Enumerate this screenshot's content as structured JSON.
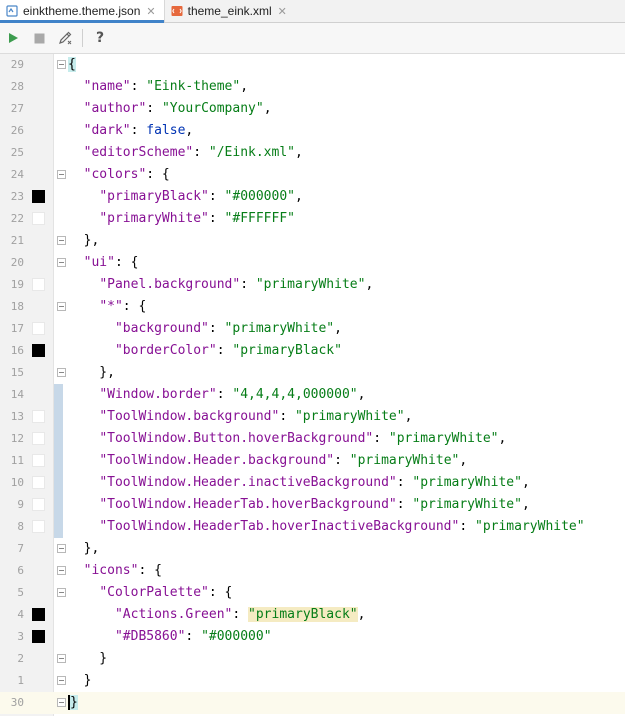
{
  "tabs": [
    {
      "label": "einktheme.theme.json",
      "icon": "json-file-icon",
      "close": "✕"
    },
    {
      "label": "theme_eink.xml",
      "icon": "xml-file-icon",
      "close": "✕"
    }
  ],
  "toolbar": {
    "run_icon": "play-icon",
    "stop_icon": "stop-icon",
    "edit_icon": "pencil-icon",
    "help_label": "?"
  },
  "colors": {
    "accent": "#4083c9",
    "key": "#871094",
    "string": "#067d17",
    "boolean": "#0033b3",
    "swatch_black": "#000000",
    "swatch_white": "#FFFFFF"
  },
  "lines": [
    {
      "num": "29",
      "segs": [
        {
          "t": "{",
          "c": "p brace-match"
        }
      ]
    },
    {
      "num": "28",
      "segs": [
        {
          "t": "  "
        },
        {
          "t": "\"name\"",
          "c": "k"
        },
        {
          "t": ": "
        },
        {
          "t": "\"Eink-theme\"",
          "c": "s"
        },
        {
          "t": ","
        }
      ]
    },
    {
      "num": "27",
      "segs": [
        {
          "t": "  "
        },
        {
          "t": "\"author\"",
          "c": "k"
        },
        {
          "t": ": "
        },
        {
          "t": "\"YourCompany\"",
          "c": "s"
        },
        {
          "t": ","
        }
      ]
    },
    {
      "num": "26",
      "segs": [
        {
          "t": "  "
        },
        {
          "t": "\"dark\"",
          "c": "k"
        },
        {
          "t": ": "
        },
        {
          "t": "false",
          "c": "b"
        },
        {
          "t": ","
        }
      ]
    },
    {
      "num": "25",
      "segs": [
        {
          "t": "  "
        },
        {
          "t": "\"editorScheme\"",
          "c": "k"
        },
        {
          "t": ": "
        },
        {
          "t": "\"/Eink.xml\"",
          "c": "s"
        },
        {
          "t": ","
        }
      ]
    },
    {
      "num": "24",
      "segs": [
        {
          "t": "  "
        },
        {
          "t": "\"colors\"",
          "c": "k"
        },
        {
          "t": ": {"
        }
      ]
    },
    {
      "num": "23",
      "swatch": "black",
      "segs": [
        {
          "t": "    "
        },
        {
          "t": "\"primaryBlack\"",
          "c": "k"
        },
        {
          "t": ": "
        },
        {
          "t": "\"#000000\"",
          "c": "s"
        },
        {
          "t": ","
        }
      ]
    },
    {
      "num": "22",
      "swatch": "white",
      "segs": [
        {
          "t": "    "
        },
        {
          "t": "\"primaryWhite\"",
          "c": "k"
        },
        {
          "t": ": "
        },
        {
          "t": "\"#FFFFFF\"",
          "c": "s"
        }
      ]
    },
    {
      "num": "21",
      "segs": [
        {
          "t": "  },"
        }
      ]
    },
    {
      "num": "20",
      "segs": [
        {
          "t": "  "
        },
        {
          "t": "\"ui\"",
          "c": "k"
        },
        {
          "t": ": {"
        }
      ]
    },
    {
      "num": "19",
      "swatch": "white",
      "segs": [
        {
          "t": "    "
        },
        {
          "t": "\"Panel.background\"",
          "c": "k"
        },
        {
          "t": ": "
        },
        {
          "t": "\"primaryWhite\"",
          "c": "s"
        },
        {
          "t": ","
        }
      ]
    },
    {
      "num": "18",
      "segs": [
        {
          "t": "    "
        },
        {
          "t": "\"*\"",
          "c": "k"
        },
        {
          "t": ": {"
        }
      ]
    },
    {
      "num": "17",
      "swatch": "white",
      "segs": [
        {
          "t": "      "
        },
        {
          "t": "\"background\"",
          "c": "k"
        },
        {
          "t": ": "
        },
        {
          "t": "\"primaryWhite\"",
          "c": "s"
        },
        {
          "t": ","
        }
      ]
    },
    {
      "num": "16",
      "swatch": "black",
      "segs": [
        {
          "t": "      "
        },
        {
          "t": "\"borderColor\"",
          "c": "k"
        },
        {
          "t": ": "
        },
        {
          "t": "\"primaryBlack\"",
          "c": "s"
        }
      ]
    },
    {
      "num": "15",
      "segs": [
        {
          "t": "    },"
        }
      ]
    },
    {
      "num": "14",
      "change": true,
      "segs": [
        {
          "t": "    "
        },
        {
          "t": "\"Window.border\"",
          "c": "k"
        },
        {
          "t": ": "
        },
        {
          "t": "\"4,4,4,4,000000\"",
          "c": "s"
        },
        {
          "t": ","
        }
      ]
    },
    {
      "num": "13",
      "change": true,
      "swatch": "white",
      "segs": [
        {
          "t": "    "
        },
        {
          "t": "\"ToolWindow.background\"",
          "c": "k"
        },
        {
          "t": ": "
        },
        {
          "t": "\"primaryWhite\"",
          "c": "s"
        },
        {
          "t": ","
        }
      ]
    },
    {
      "num": "12",
      "change": true,
      "swatch": "white",
      "segs": [
        {
          "t": "    "
        },
        {
          "t": "\"ToolWindow.Button.hoverBackground\"",
          "c": "k"
        },
        {
          "t": ": "
        },
        {
          "t": "\"primaryWhite\"",
          "c": "s"
        },
        {
          "t": ","
        }
      ]
    },
    {
      "num": "11",
      "change": true,
      "swatch": "white",
      "segs": [
        {
          "t": "    "
        },
        {
          "t": "\"ToolWindow.Header.background\"",
          "c": "k"
        },
        {
          "t": ": "
        },
        {
          "t": "\"primaryWhite\"",
          "c": "s"
        },
        {
          "t": ","
        }
      ]
    },
    {
      "num": "10",
      "change": true,
      "swatch": "white",
      "segs": [
        {
          "t": "    "
        },
        {
          "t": "\"ToolWindow.Header.inactiveBackground\"",
          "c": "k"
        },
        {
          "t": ": "
        },
        {
          "t": "\"primaryWhite\"",
          "c": "s"
        },
        {
          "t": ","
        }
      ]
    },
    {
      "num": "9",
      "change": true,
      "swatch": "white",
      "segs": [
        {
          "t": "    "
        },
        {
          "t": "\"ToolWindow.HeaderTab.hoverBackground\"",
          "c": "k"
        },
        {
          "t": ": "
        },
        {
          "t": "\"primaryWhite\"",
          "c": "s"
        },
        {
          "t": ","
        }
      ]
    },
    {
      "num": "8",
      "change": true,
      "swatch": "white",
      "segs": [
        {
          "t": "    "
        },
        {
          "t": "\"ToolWindow.HeaderTab.hoverInactiveBackground\"",
          "c": "k"
        },
        {
          "t": ": "
        },
        {
          "t": "\"primaryWhite\"",
          "c": "s"
        }
      ]
    },
    {
      "num": "7",
      "segs": [
        {
          "t": "  },"
        }
      ]
    },
    {
      "num": "6",
      "segs": [
        {
          "t": "  "
        },
        {
          "t": "\"icons\"",
          "c": "k"
        },
        {
          "t": ": {"
        }
      ]
    },
    {
      "num": "5",
      "segs": [
        {
          "t": "    "
        },
        {
          "t": "\"ColorPalette\"",
          "c": "k"
        },
        {
          "t": ": {"
        }
      ]
    },
    {
      "num": "4",
      "swatch": "black",
      "segs": [
        {
          "t": "      "
        },
        {
          "t": "\"Actions.Green\"",
          "c": "k"
        },
        {
          "t": ": "
        },
        {
          "t": "\"primaryBlack\"",
          "c": "s hl"
        },
        {
          "t": ","
        }
      ]
    },
    {
      "num": "3",
      "swatch": "black",
      "segs": [
        {
          "t": "      "
        },
        {
          "t": "\"#DB5860\"",
          "c": "k"
        },
        {
          "t": ": "
        },
        {
          "t": "\"#000000\"",
          "c": "s"
        }
      ]
    },
    {
      "num": "2",
      "segs": [
        {
          "t": "    }"
        }
      ]
    },
    {
      "num": "1",
      "segs": [
        {
          "t": "  }"
        }
      ]
    },
    {
      "num": "30",
      "current": true,
      "segs": [
        {
          "t": "}",
          "c": "p brace-match caret"
        }
      ]
    }
  ]
}
